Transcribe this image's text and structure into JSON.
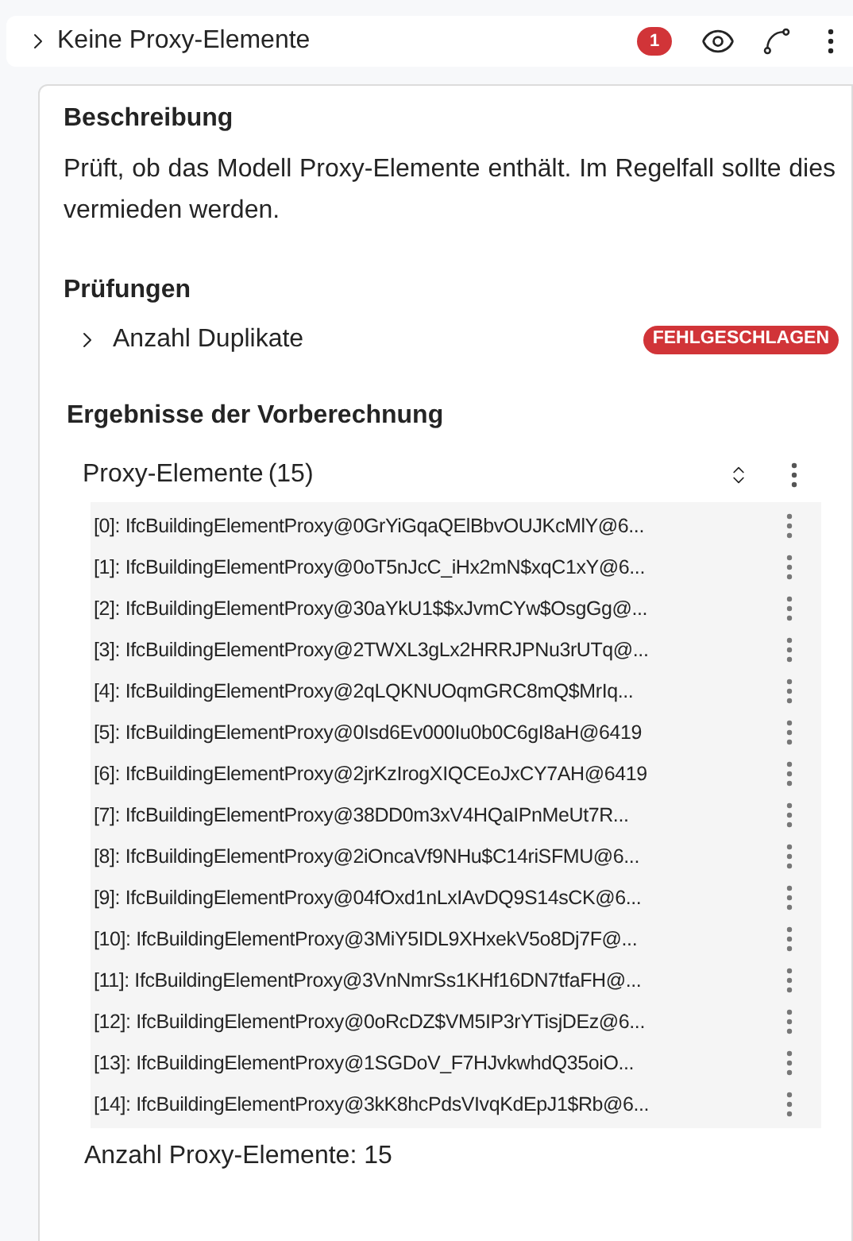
{
  "header": {
    "title": "Keine Proxy-Elemente",
    "expanded": false,
    "count": "1"
  },
  "description": {
    "heading": "Beschreibung",
    "text": "Prüft, ob das Modell Proxy-Elemente enthält. Im Regelfall sollte dies vermieden werden."
  },
  "checks": {
    "heading": "Prüfungen",
    "items": [
      {
        "label": "Anzahl Duplikate",
        "expanded": false,
        "status": "FEHLGESCHLAGEN"
      }
    ]
  },
  "precalc": {
    "heading": "Ergebnisse der Vorberechnung",
    "group": {
      "title": "Proxy-Elemente",
      "count": "(15)",
      "items": [
        "[0]: IfcBuildingElementProxy@0GrYiGqaQElBbvOUJKcMlY@6...",
        "[1]: IfcBuildingElementProxy@0oT5nJcC_iHx2mN$xqC1xY@6...",
        "[2]: IfcBuildingElementProxy@30aYkU1$$xJvmCYw$OsgGg@...",
        "[3]: IfcBuildingElementProxy@2TWXL3gLx2HRRJPNu3rUTq@...",
        "[4]: IfcBuildingElementProxy@2qLQKNUOqmGRC8mQ$MrIq...",
        "[5]: IfcBuildingElementProxy@0Isd6Ev000Iu0b0C6gI8aH@6419",
        "[6]: IfcBuildingElementProxy@2jrKzIrogXIQCEoJxCY7AH@6419",
        "[7]: IfcBuildingElementProxy@38DD0m3xV4HQaIPnMeUt7R...",
        "[8]: IfcBuildingElementProxy@2iOncaVf9NHu$C14riSFMU@6...",
        "[9]: IfcBuildingElementProxy@04fOxd1nLxIAvDQ9S14sCK@6...",
        "[10]: IfcBuildingElementProxy@3MiY5IDL9XHxekV5o8Dj7F@...",
        "[11]: IfcBuildingElementProxy@3VnNmrSs1KHf16DN7tfaFH@...",
        "[12]: IfcBuildingElementProxy@0oRcDZ$VM5IP3rYTisjDEz@6...",
        "[13]: IfcBuildingElementProxy@1SGDoV_F7HJvkwhdQ35oiO...",
        "[14]: IfcBuildingElementProxy@3kK8hcPdsVIvqKdEpJ1$Rb@6..."
      ]
    },
    "summary": "Anzahl Proxy-Elemente: 15"
  }
}
